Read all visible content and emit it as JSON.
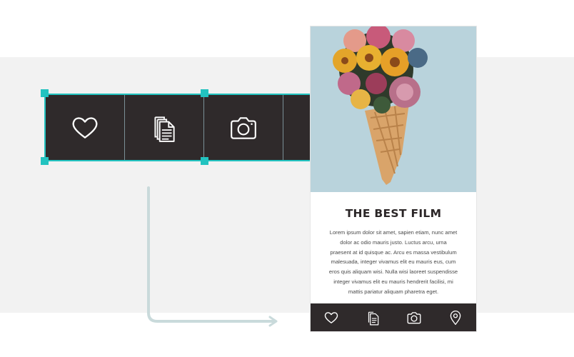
{
  "colors": {
    "accent": "#22c3c0",
    "bar": "#2f2a2b",
    "divider": "#7a8f96",
    "icon_stroke": "#ffffff",
    "connector": "#c9dadb",
    "background_band": "#f2f2f2"
  },
  "toolbar": {
    "items": [
      {
        "icon": "heart-icon"
      },
      {
        "icon": "documents-icon"
      },
      {
        "icon": "camera-icon"
      },
      {
        "icon": "location-pin-icon"
      }
    ]
  },
  "phone": {
    "hero_image": "ice-cream-cone-with-flowers",
    "title": "THE BEST FILM",
    "body_lines": [
      "Lorem ipsum dolor sit amet, sapien etiam, nunc amet",
      "dolor ac odio mauris justo. Luctus arcu, urna",
      "praesent at id quisque ac. Arcu es massa vestibulum",
      "malesuada, integer vivamus elit eu mauris eus, cum",
      "eros quis aliquam wisi. Nulla wisi laoreet suspendisse",
      "integer vivamus elit eu mauris hendrerit facilisi, mi",
      "mattis pariatur aliquam pharetra eget."
    ],
    "bottom_bar": [
      {
        "icon": "heart-icon"
      },
      {
        "icon": "documents-icon"
      },
      {
        "icon": "camera-icon"
      },
      {
        "icon": "location-pin-icon"
      }
    ]
  }
}
